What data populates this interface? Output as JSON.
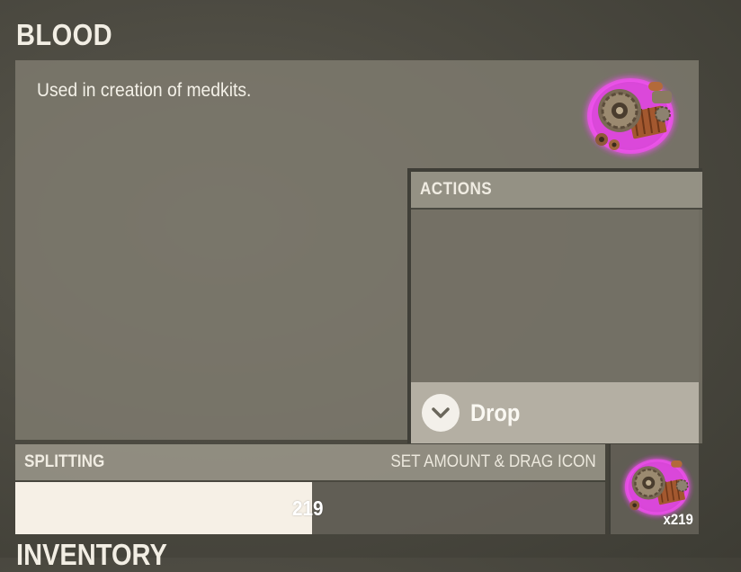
{
  "item": {
    "title": "BLOOD",
    "description": "Used in creation of medkits.",
    "icon": "gears-scrap-icon",
    "glow_color": "#ff3cff"
  },
  "actions": {
    "header": "ACTIONS",
    "drop_label": "Drop",
    "drop_icon": "chevron-down-icon"
  },
  "splitting": {
    "title": "SPLITTING",
    "hint": "SET AMOUNT & DRAG ICON",
    "value": "219",
    "fill_fraction": 0.503
  },
  "slot": {
    "count": "x219"
  },
  "inventory": {
    "title": "INVENTORY"
  }
}
